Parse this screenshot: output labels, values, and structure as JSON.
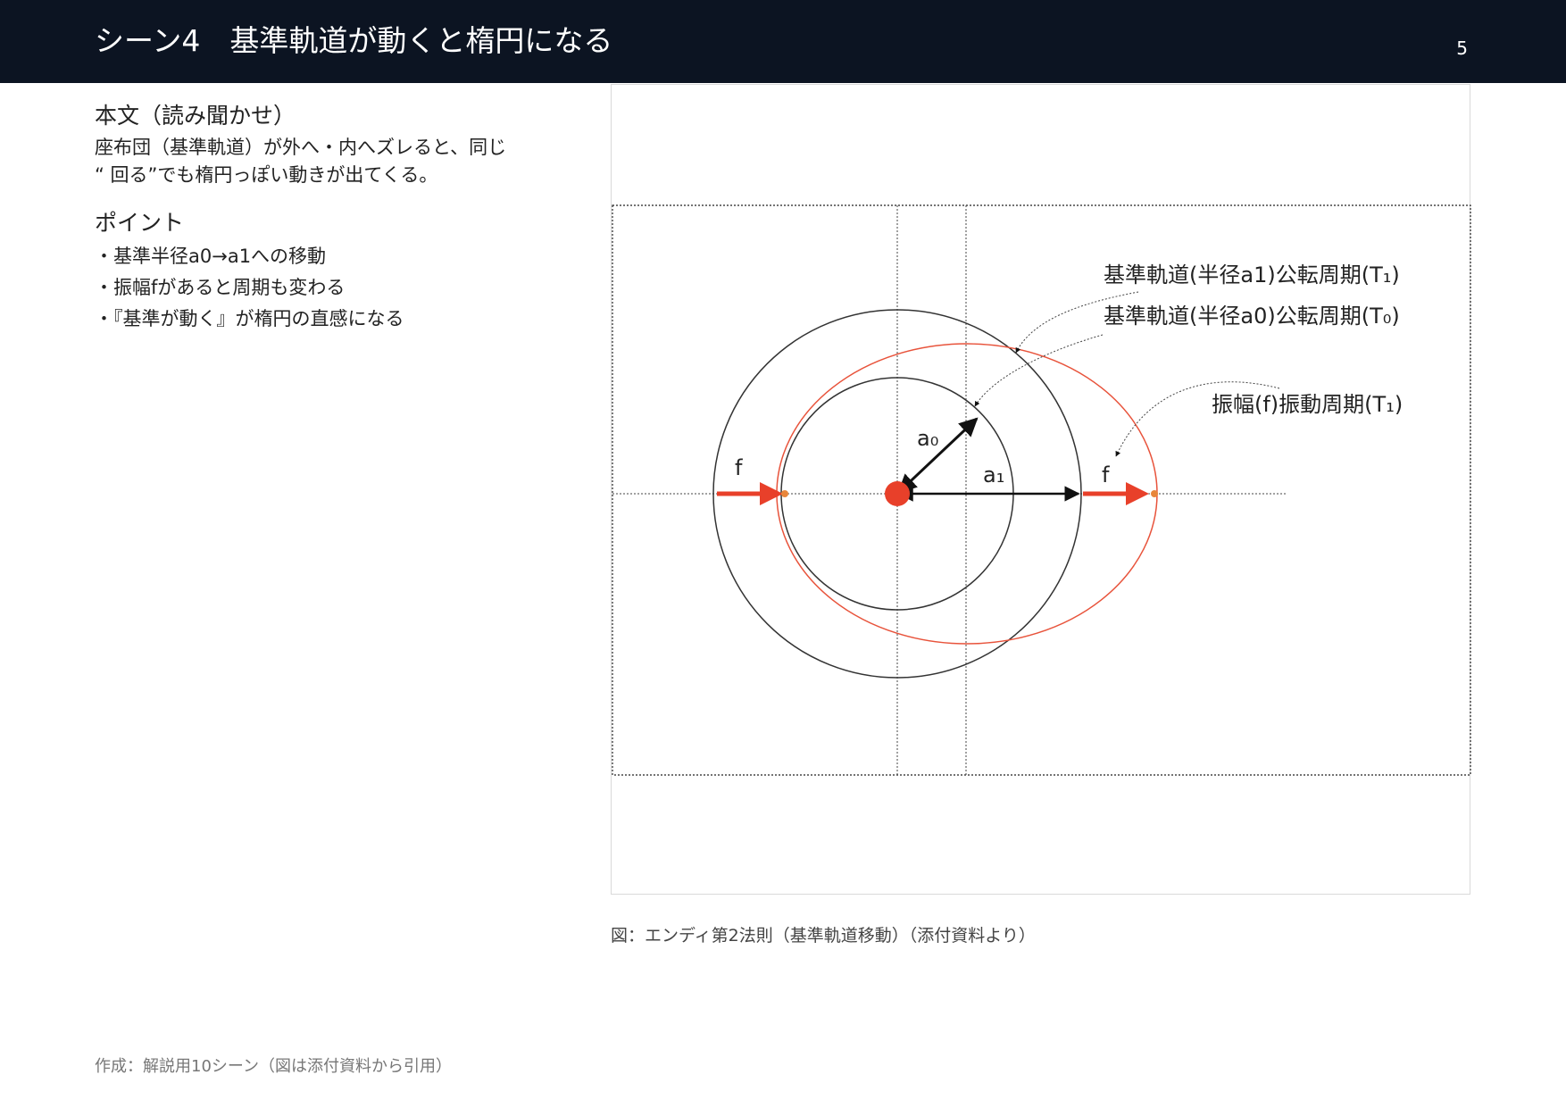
{
  "header": {
    "title": "シーン4　基準軌道が動くと楕円になる",
    "page_number": "5"
  },
  "left": {
    "body_heading": "本文（読み聞かせ）",
    "body_text": "座布団（基準軌道）が外へ・内へズレると、同じ\n“ 回る”でも楕円っぽい動きが出てくる。",
    "points_heading": "ポイント",
    "points": [
      "・基準半径a0→a1への移動",
      "・振幅fがあると周期も変わる",
      "・『基準が動く』が楕円の直感になる"
    ]
  },
  "figure": {
    "labels": {
      "orbit_a1": "基準軌道(半径a1)公転周期(T₁)",
      "orbit_a0": "基準軌道(半径a0)公転周期(T₀)",
      "amplitude": "振幅(f)振動周期(T₁)",
      "f_left": "f",
      "f_right": "f",
      "a0": "a₀",
      "a1": "a₁"
    },
    "colors": {
      "ellipse": "#e8533b",
      "arrow": "#e8402a",
      "dot": "#e8402a",
      "line": "#333333"
    }
  },
  "caption": "図：エンディ第2法則（基準軌道移動）（添付資料より）",
  "footer": "作成：解説用10シーン（図は添付資料から引用）"
}
